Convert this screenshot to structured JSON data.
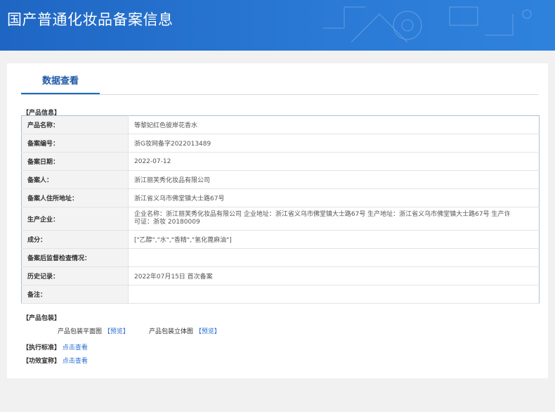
{
  "header": {
    "title": "国产普通化妆品备案信息"
  },
  "tab": {
    "label": "数据查看"
  },
  "product_info": {
    "section_title": "【产品信息】",
    "rows": [
      {
        "label": "产品名称：",
        "value": "等黎妃红色彼岸花香水"
      },
      {
        "label": "备案编号：",
        "value": "浙G妆网备字2022013489"
      },
      {
        "label": "备案日期：",
        "value": "2022-07-12"
      },
      {
        "label": "备案人：",
        "value": "浙江丽芙秀化妆品有限公司"
      },
      {
        "label": "备案人住所地址：",
        "value": "浙江省义乌市佛堂镇大士路67号"
      },
      {
        "label": "生产企业：",
        "value": "企业名称：浙江丽芙秀化妆品有限公司 企业地址：浙江省义乌市佛堂镇大士路67号 生产地址：浙江省义乌市佛堂镇大士路67号 生产许可证：浙妆 20180009"
      },
      {
        "label": "成分：",
        "value": "[\"乙醇\",\"水\",\"香精\",\"氢化蓖麻油\"]"
      },
      {
        "label": "备案后监督检查情况：",
        "value": ""
      },
      {
        "label": "历史记录：",
        "value": "2022年07月15日 首次备案"
      },
      {
        "label": "备注：",
        "value": ""
      }
    ]
  },
  "packaging": {
    "section_title": "【产品包装】",
    "flat_label": "产品包装平面图",
    "flat_link": "【预览】",
    "solid_label": "产品包装立体图",
    "solid_link": "【预览】"
  },
  "standard": {
    "label": "【执行标准】",
    "link": "点击查看"
  },
  "efficacy": {
    "label": "【功效宣称】",
    "link": "点击查看"
  }
}
